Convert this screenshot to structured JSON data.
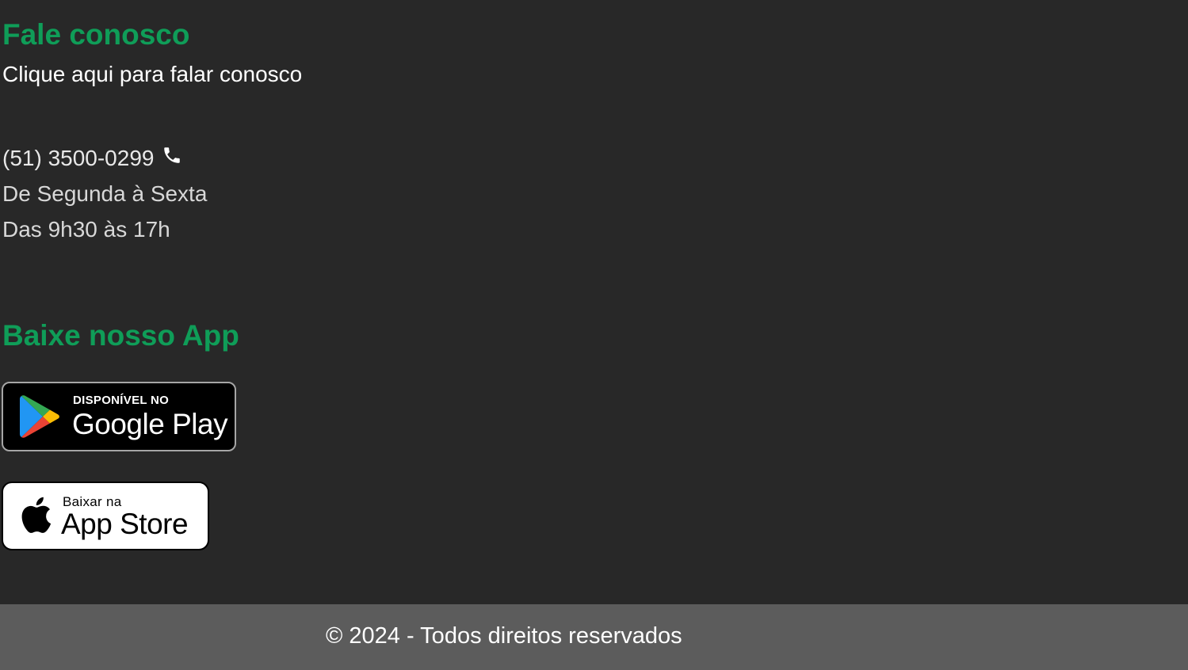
{
  "contact": {
    "heading": "Fale conosco",
    "link_text": "Clique aqui para falar conosco",
    "phone": "(51) 3500-0299",
    "hours_days": "De Segunda à Sexta",
    "hours_time": "Das 9h30 às 17h"
  },
  "app": {
    "heading": "Baixe nosso App",
    "google_play": {
      "small_label": "DISPONÍVEL NO",
      "big_label": "Google Play"
    },
    "app_store": {
      "small_label": "Baixar na",
      "big_label": "App Store"
    }
  },
  "footer": {
    "copyright": "© 2024 - Todos direitos reservados"
  },
  "colors": {
    "accent_green": "#0f9d58",
    "background": "#282828",
    "footer_background": "#5c5c5c"
  },
  "icons": {
    "phone": "phone-icon",
    "google_play": "google-play-icon",
    "apple": "apple-icon"
  }
}
